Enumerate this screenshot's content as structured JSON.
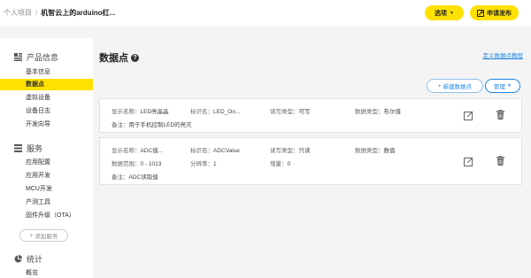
{
  "header": {
    "breadcrumb_root": "个人项目",
    "breadcrumb_sep": "/",
    "breadcrumb_current": "机智云上的arduino红...",
    "options_label": "选项",
    "publish_label": "申请发布"
  },
  "sidebar": {
    "sections": [
      {
        "title": "产品信息",
        "icon": "product-icon"
      },
      {
        "title": "服务",
        "icon": "service-icon"
      },
      {
        "title": "统计",
        "icon": "pie-chart-icon"
      }
    ],
    "product_items": [
      "基本信息",
      "数据点",
      "虚拟设备",
      "设备日志",
      "开发向导"
    ],
    "service_items": [
      "应用配置",
      "应用开发",
      "MCU开发",
      "产测工具",
      "固件升级（OTA）"
    ],
    "add_service_label": "添加服务",
    "stats_items": [
      "概览"
    ]
  },
  "main": {
    "title": "数据点",
    "tutorial_link": "定义数据点教程",
    "new_button": "新建数据点",
    "manage_button": "管理",
    "datapoints": [
      {
        "display_name_label": "显示名称：",
        "display_name": "LED亮晶晶",
        "identifier_label": "标识名：",
        "identifier": "LED_On...",
        "rw_label": "读写类型：",
        "rw": "可写",
        "dtype_label": "数据类型：",
        "dtype": "布尔值",
        "note_label": "备注：",
        "note": "用于手机控制LED的亮灭"
      },
      {
        "display_name_label": "显示名称：",
        "display_name": "ADC值...",
        "identifier_label": "标识名：",
        "identifier": "ADCValue",
        "rw_label": "读写类型：",
        "rw": "只读",
        "dtype_label": "数据类型：",
        "dtype": "数值",
        "range_label": "数据范围：",
        "range": "0 - 1023",
        "resolution_label": "分辨率：",
        "resolution": "1",
        "increment_label": "增量：",
        "increment": "0",
        "note_label": "备注：",
        "note": "ADC读取值"
      }
    ]
  },
  "colors": {
    "accent": "#ffe100",
    "link": "#1e88e5"
  }
}
